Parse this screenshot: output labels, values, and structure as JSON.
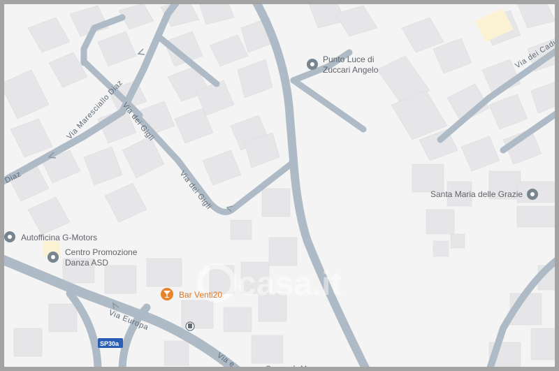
{
  "map": {
    "roads": {
      "via_maresciallo_diaz": "Via Maresciallo Diaz",
      "via_diaz_fragment": "o Diaz",
      "via_dei_gigli_upper": "Via dei Gigli",
      "via_dei_gigli_lower": "Via dei Gigli",
      "via_europa": "Via Europa",
      "via_europa_lower": "Via e",
      "via_dei_caduti": "Via dei Cadut",
      "bottom_fragment": "Corso d. Ma..."
    },
    "route_badge": "SP30a",
    "pois": {
      "punto_luce_line1": "Punto Luce di",
      "punto_luce_line2": "Zuccari Angelo",
      "santa_maria": "Santa Maria delle Grazie",
      "autofficina": "Autofficina G-Motors",
      "centro_line1": "Centro Promozione",
      "centro_line2": "Danza ASD",
      "bar_venti": "Bar Venti20"
    },
    "watermark": "casa.it",
    "colors": {
      "background": "#f4f4f4",
      "building": "#e6e6e8",
      "road": "#aebac5",
      "poi_grey": "#78858f",
      "poi_orange": "#e8832a",
      "badge": "#2a5eb5"
    }
  }
}
